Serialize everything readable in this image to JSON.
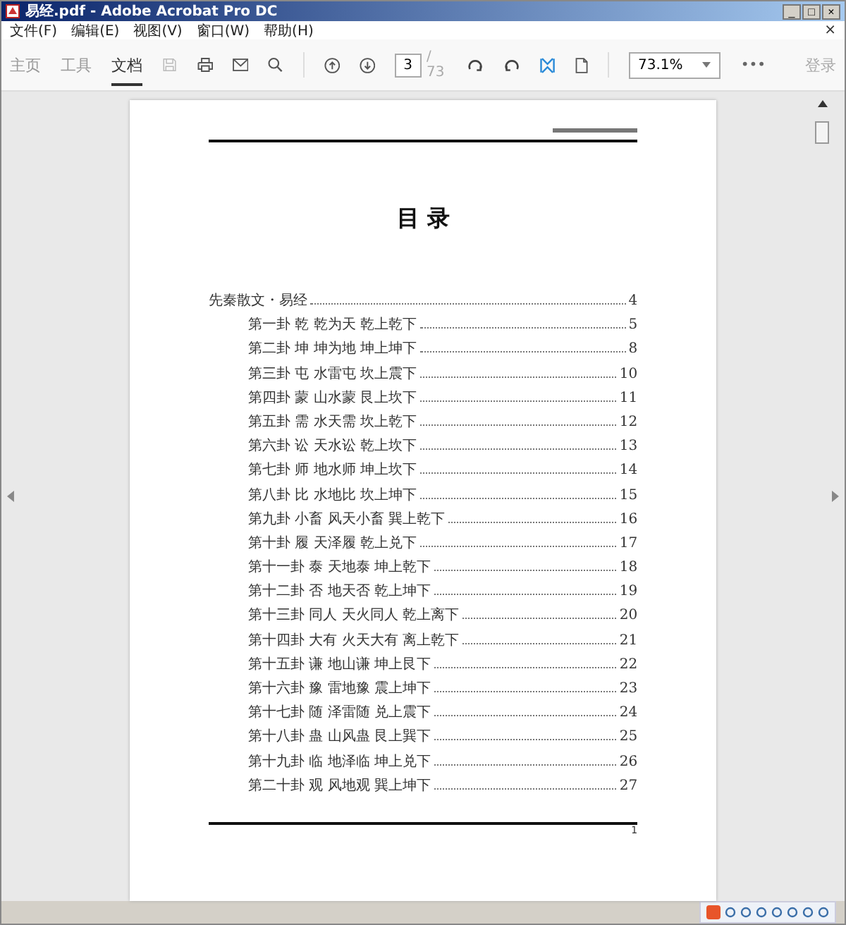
{
  "window": {
    "title": "易经.pdf - Adobe Acrobat Pro DC",
    "controls": [
      "_",
      "□",
      "×"
    ]
  },
  "menu": [
    "文件(F)",
    "编辑(E)",
    "视图(V)",
    "窗口(W)",
    "帮助(H)"
  ],
  "menu_close": "×",
  "tabs": [
    {
      "label": "主页",
      "selected": false
    },
    {
      "label": "工具",
      "selected": false
    },
    {
      "label": "文档",
      "selected": true
    }
  ],
  "toolbar": {
    "page": "3",
    "page_total": "/ 73",
    "zoom": "73.1%",
    "more": "•••",
    "sign_in": "登录"
  },
  "document": {
    "heading": "目 录",
    "page_number": "1",
    "toc": [
      {
        "title": "先秦散文・易经",
        "page": "4",
        "children": [
          {
            "title": "第一卦 乾 乾为天 乾上乾下",
            "page": "5"
          },
          {
            "title": "第二卦 坤 坤为地 坤上坤下",
            "page": "8"
          },
          {
            "title": "第三卦 屯 水雷屯 坎上震下",
            "page": "10"
          },
          {
            "title": "第四卦 蒙 山水蒙 艮上坎下",
            "page": "11"
          },
          {
            "title": "第五卦 需 水天需 坎上乾下",
            "page": "12"
          },
          {
            "title": "第六卦 讼 天水讼 乾上坎下",
            "page": "13"
          },
          {
            "title": "第七卦 师 地水师 坤上坎下",
            "page": "14"
          },
          {
            "title": "第八卦 比 水地比 坎上坤下",
            "page": "15"
          },
          {
            "title": "第九卦 小畜 风天小畜 巽上乾下",
            "page": "16"
          },
          {
            "title": "第十卦 履 天泽履 乾上兑下",
            "page": "17"
          },
          {
            "title": "第十一卦 泰 天地泰 坤上乾下",
            "page": "18"
          },
          {
            "title": "第十二卦 否 地天否 乾上坤下",
            "page": "19"
          },
          {
            "title": "第十三卦 同人 天火同人 乾上离下",
            "page": "20"
          },
          {
            "title": "第十四卦 大有 火天大有 离上乾下",
            "page": "21"
          },
          {
            "title": "第十五卦 谦 地山谦 坤上艮下",
            "page": "22"
          },
          {
            "title": "第十六卦 豫 雷地豫 震上坤下",
            "page": "23"
          },
          {
            "title": "第十七卦 随 泽雷随 兑上震下",
            "page": "24"
          },
          {
            "title": "第十八卦 蛊 山风蛊 艮上巽下",
            "page": "25"
          },
          {
            "title": "第十九卦 临 地泽临 坤上兑下",
            "page": "26"
          },
          {
            "title": "第二十卦 观 风地观 巽上坤下",
            "page": "27"
          }
        ]
      }
    ]
  }
}
